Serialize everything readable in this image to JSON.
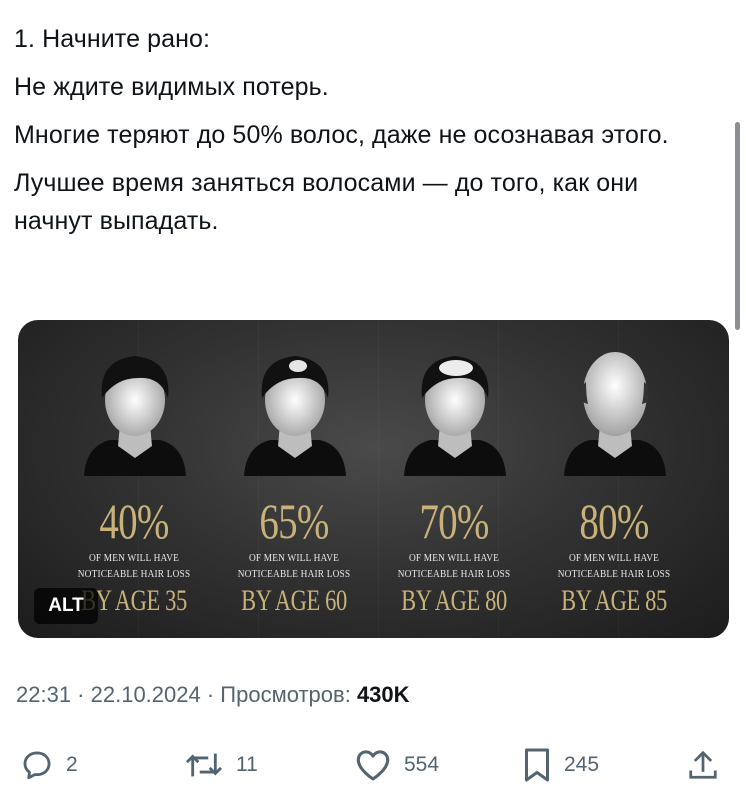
{
  "post": {
    "lines": [
      "1. Начните рано:",
      "Не ждите видимых потерь.",
      "Многие теряют до 50% волос, даже не осознавая этого.",
      "Лучшее время заняться волосами — до того, как они начнут выпадать."
    ]
  },
  "media": {
    "alt_badge": "ALT",
    "columns": [
      {
        "percent": "40%",
        "line1": "OF MEN WILL HAVE",
        "line2": "NOTICEABLE HAIR LOSS",
        "age": "BY AGE 35"
      },
      {
        "percent": "65%",
        "line1": "OF MEN WILL HAVE",
        "line2": "NOTICEABLE HAIR LOSS",
        "age": "BY AGE 60"
      },
      {
        "percent": "70%",
        "line1": "OF MEN WILL HAVE",
        "line2": "NOTICEABLE HAIR LOSS",
        "age": "BY AGE 80"
      },
      {
        "percent": "80%",
        "line1": "OF MEN WILL HAVE",
        "line2": "NOTICEABLE HAIR LOSS",
        "age": "BY AGE 85"
      }
    ],
    "accent_color": "#c8b27a"
  },
  "meta": {
    "time": "22:31",
    "separator": " · ",
    "date": "22.10.2024",
    "views_label": "Просмотров:",
    "views_count": "430K"
  },
  "actions": {
    "replies": "2",
    "reposts": "11",
    "likes": "554",
    "bookmarks": "245",
    "icons": [
      "reply-icon",
      "repost-icon",
      "like-icon",
      "bookmark-icon",
      "share-icon"
    ]
  }
}
